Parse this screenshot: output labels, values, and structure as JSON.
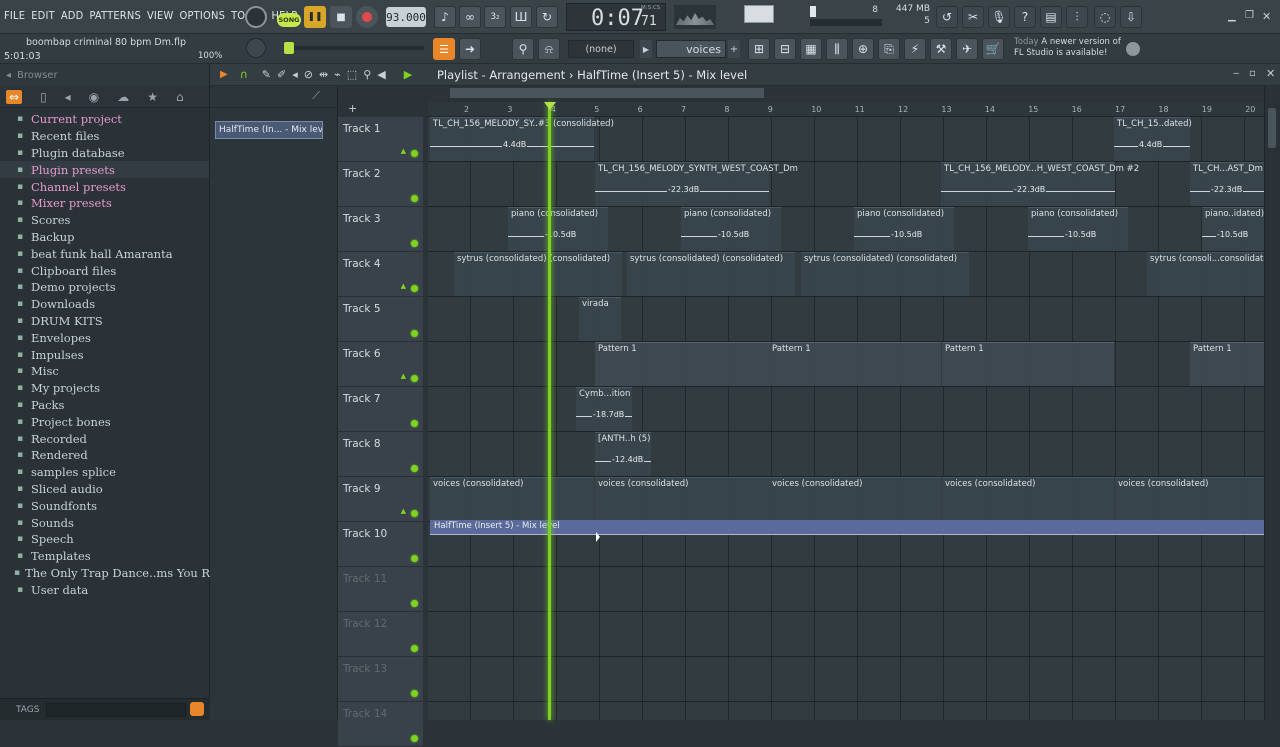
{
  "menu": [
    "FILE",
    "EDIT",
    "ADD",
    "PATTERNS",
    "VIEW",
    "OPTIONS",
    "TOOLS",
    "HELP"
  ],
  "transport": {
    "song_label": "SONG",
    "tempo": "93.000",
    "time": "0:07",
    "time_frac": "71",
    "time_unit": "M:S:CS",
    "cpu_value": "8",
    "mem": "447 MB",
    "mem_sub": "5"
  },
  "project": {
    "filename": "boombap criminal 80 bpm Dm.flp",
    "time": "5:01:03",
    "zoom": "100%"
  },
  "second_bar": {
    "pattern_none": "(none)",
    "pattern_name": "voices",
    "news_prefix": "Today",
    "news_text": "A newer version of FL Studio is available!"
  },
  "browser": {
    "header": "Browser",
    "items": [
      {
        "label": "Current project",
        "hl": true
      },
      {
        "label": "Recent files",
        "hl": false
      },
      {
        "label": "Plugin database",
        "hl": false
      },
      {
        "label": "Plugin presets",
        "hl": true
      },
      {
        "label": "Channel presets",
        "hl": true
      },
      {
        "label": "Mixer presets",
        "hl": true
      },
      {
        "label": "Scores",
        "hl": false
      },
      {
        "label": "Backup",
        "hl": false
      },
      {
        "label": "beat funk hall Amaranta",
        "hl": false
      },
      {
        "label": "Clipboard files",
        "hl": false
      },
      {
        "label": "Demo projects",
        "hl": false
      },
      {
        "label": "Downloads",
        "hl": false
      },
      {
        "label": "DRUM KITS",
        "hl": false
      },
      {
        "label": "Envelopes",
        "hl": false
      },
      {
        "label": "Impulses",
        "hl": false
      },
      {
        "label": "Misc",
        "hl": false
      },
      {
        "label": "My projects",
        "hl": false
      },
      {
        "label": "Packs",
        "hl": false
      },
      {
        "label": "Project bones",
        "hl": false
      },
      {
        "label": "Recorded",
        "hl": false
      },
      {
        "label": "Rendered",
        "hl": false
      },
      {
        "label": "samples splice",
        "hl": false
      },
      {
        "label": "Sliced audio",
        "hl": false
      },
      {
        "label": "Soundfonts",
        "hl": false
      },
      {
        "label": "Sounds",
        "hl": false
      },
      {
        "label": "Speech",
        "hl": false
      },
      {
        "label": "Templates",
        "hl": false
      },
      {
        "label": "The Only Trap Dance..ms You Raelly Need",
        "hl": false
      },
      {
        "label": "User data",
        "hl": false
      }
    ],
    "tags_label": "TAGS"
  },
  "playlist": {
    "title": "Playlist - Arrangement",
    "breadcrumb": "HalfTime (Insert 5) - Mix level",
    "selected_clip": "HalfTime (In... - Mix level",
    "ruler": [
      "2",
      "3",
      "4",
      "5",
      "6",
      "7",
      "8",
      "9",
      "10",
      "11",
      "12",
      "13",
      "14",
      "15",
      "16",
      "17",
      "18",
      "19",
      "20"
    ],
    "tracks": [
      "Track 1",
      "Track 2",
      "Track 3",
      "Track 4",
      "Track 5",
      "Track 6",
      "Track 7",
      "Track 8",
      "Track 9",
      "Track 10",
      "Track 11",
      "Track 12",
      "Track 13",
      "Track 14"
    ],
    "clips": {
      "t1a": "TL_CH_156_MELODY_SY..#3 (consolidated)",
      "t1a_v": "4.4dB",
      "t1b": "TL_CH_15..dated)",
      "t1b_v": "4.4dB",
      "t2a": "TL_CH_156_MELODY_SYNTH_WEST_COAST_Dm",
      "t2a_v": "-22.3dB",
      "t2b": "TL_CH_156_MELODY...H_WEST_COAST_Dm #2",
      "t2b_v": "-22.3dB",
      "t2c": "TL_CH...AST_Dm",
      "t2c_v": "-22.3dB",
      "t3a": "piano (consolidated)",
      "t3_v": "-10.5dB",
      "t3e": "piano..idated)",
      "t4a": "sytrus (consolidated) (consolidated)",
      "t4d": "sytrus (consoli...consolidated)",
      "t5a": "virada",
      "t6a": "Pattern 1",
      "t7a": "Cymb...ition",
      "t7a_v": "-18.7dB",
      "t8a": "[ANTH..h (5)",
      "t8a_v": "-12.4dB",
      "t9a": "voices (consolidated)",
      "t10a": "HalfTime (Insert 5) - Mix level"
    }
  }
}
